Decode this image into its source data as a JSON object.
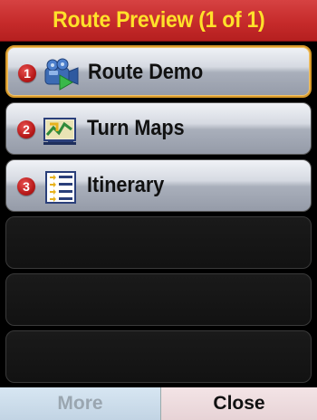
{
  "title": "Route Preview (1 of 1)",
  "menu": {
    "items": [
      {
        "number": "1",
        "label": "Route Demo",
        "icon": "video-camera-icon"
      },
      {
        "number": "2",
        "label": "Turn Maps",
        "icon": "turn-map-icon"
      },
      {
        "number": "3",
        "label": "Itinerary",
        "icon": "itinerary-list-icon"
      }
    ]
  },
  "buttons": {
    "more": "More",
    "close": "Close"
  },
  "colors": {
    "title_bar": "#c62b2b",
    "title_text": "#ffe12a",
    "selected_border": "#d89a2a",
    "badge": "#b81a1a"
  }
}
